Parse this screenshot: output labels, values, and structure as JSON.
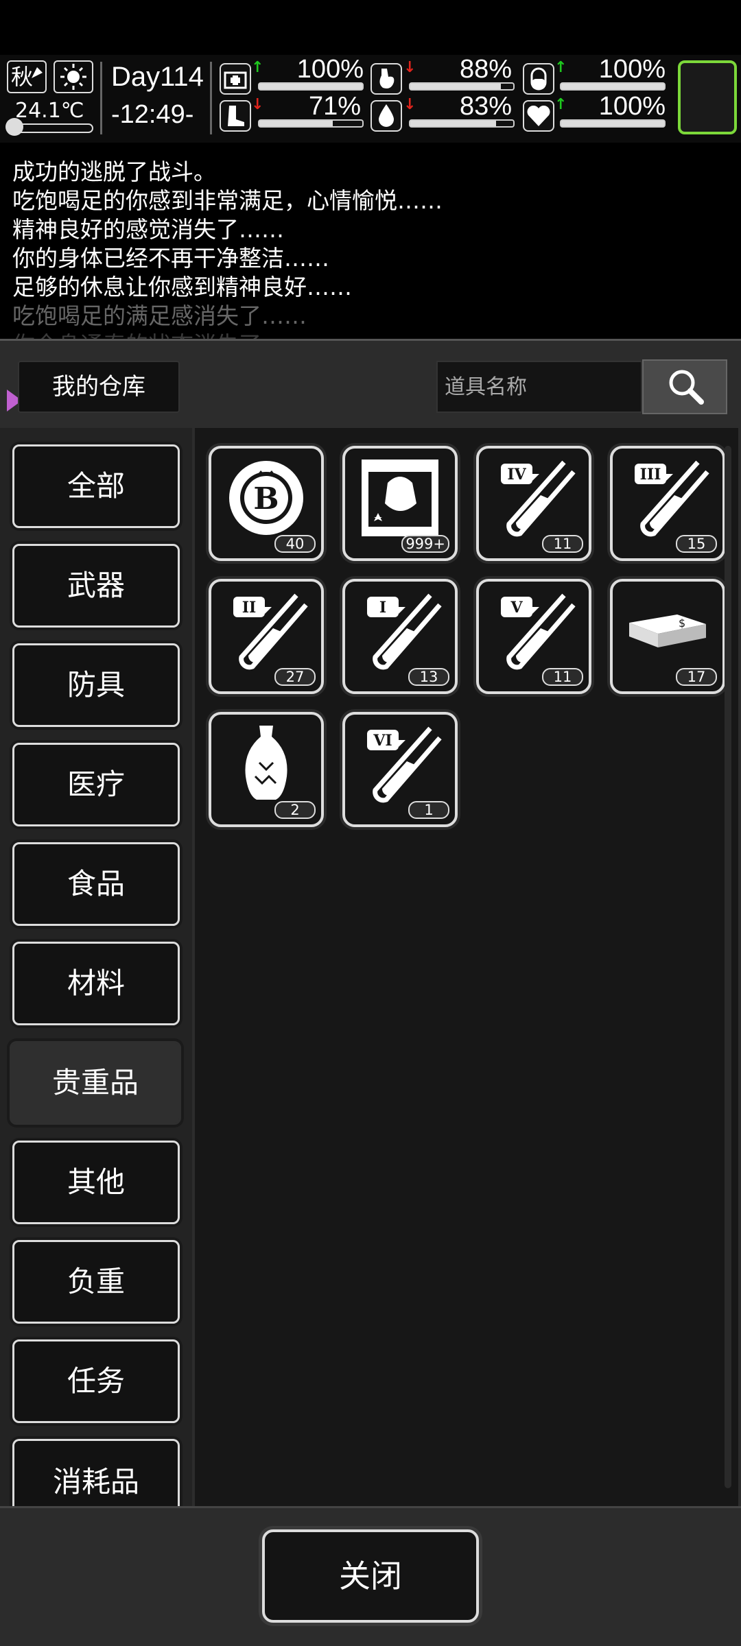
{
  "status": {
    "season": "秋",
    "temperature": "24.1℃",
    "day": "Day114",
    "time": "-12:49-",
    "stats": [
      {
        "icon": "medkit-icon",
        "arrow": "up",
        "value": "100%",
        "level": 1.0
      },
      {
        "icon": "stomach-icon",
        "arrow": "down",
        "value": "88%",
        "level": 0.88
      },
      {
        "icon": "pill-icon",
        "arrow": "up",
        "value": "100%",
        "level": 1.0
      },
      {
        "icon": "boot-icon",
        "arrow": "down",
        "value": "71%",
        "level": 0.71
      },
      {
        "icon": "water-drop-icon",
        "arrow": "down",
        "value": "83%",
        "level": 0.83
      },
      {
        "icon": "heart-icon",
        "arrow": "up",
        "value": "100%",
        "level": 1.0
      }
    ]
  },
  "log": [
    "成功的逃脱了战斗。",
    "吃饱喝足的你感到非常满足，心情愉悦……",
    "精神良好的感觉消失了……",
    "你的身体已经不再干净整洁……",
    "足够的休息让你感到精神良好……",
    "吃饱喝足的满足感消失了……",
    "你全身通泰的状态消失了……"
  ],
  "warehouse": {
    "title": "我的仓库",
    "search_placeholder": "道具名称"
  },
  "categories": [
    "全部",
    "武器",
    "防具",
    "医疗",
    "食品",
    "材料",
    "贵重品",
    "其他",
    "负重",
    "任务",
    "消耗品"
  ],
  "active_category": "贵重品",
  "items": [
    {
      "icon": "bitcoin-chip-icon",
      "qty": "40"
    },
    {
      "icon": "film-creature-icon",
      "qty": "999+"
    },
    {
      "icon": "test-tube-iv-icon",
      "tier": "IV",
      "qty": "11"
    },
    {
      "icon": "test-tube-iii-icon",
      "tier": "III",
      "qty": "15"
    },
    {
      "icon": "test-tube-ii-icon",
      "tier": "II",
      "qty": "27"
    },
    {
      "icon": "test-tube-i-icon",
      "tier": "I",
      "qty": "13"
    },
    {
      "icon": "test-tube-v-icon",
      "tier": "V",
      "qty": "11"
    },
    {
      "icon": "cash-stack-icon",
      "qty": "17"
    },
    {
      "icon": "vase-icon",
      "qty": "2"
    },
    {
      "icon": "test-tube-vi-icon",
      "tier": "VI",
      "qty": "1"
    }
  ],
  "close_label": "关闭",
  "colors": {
    "up": "#1ec81e",
    "down": "#e0241c",
    "accent_green": "#7cd83a"
  }
}
